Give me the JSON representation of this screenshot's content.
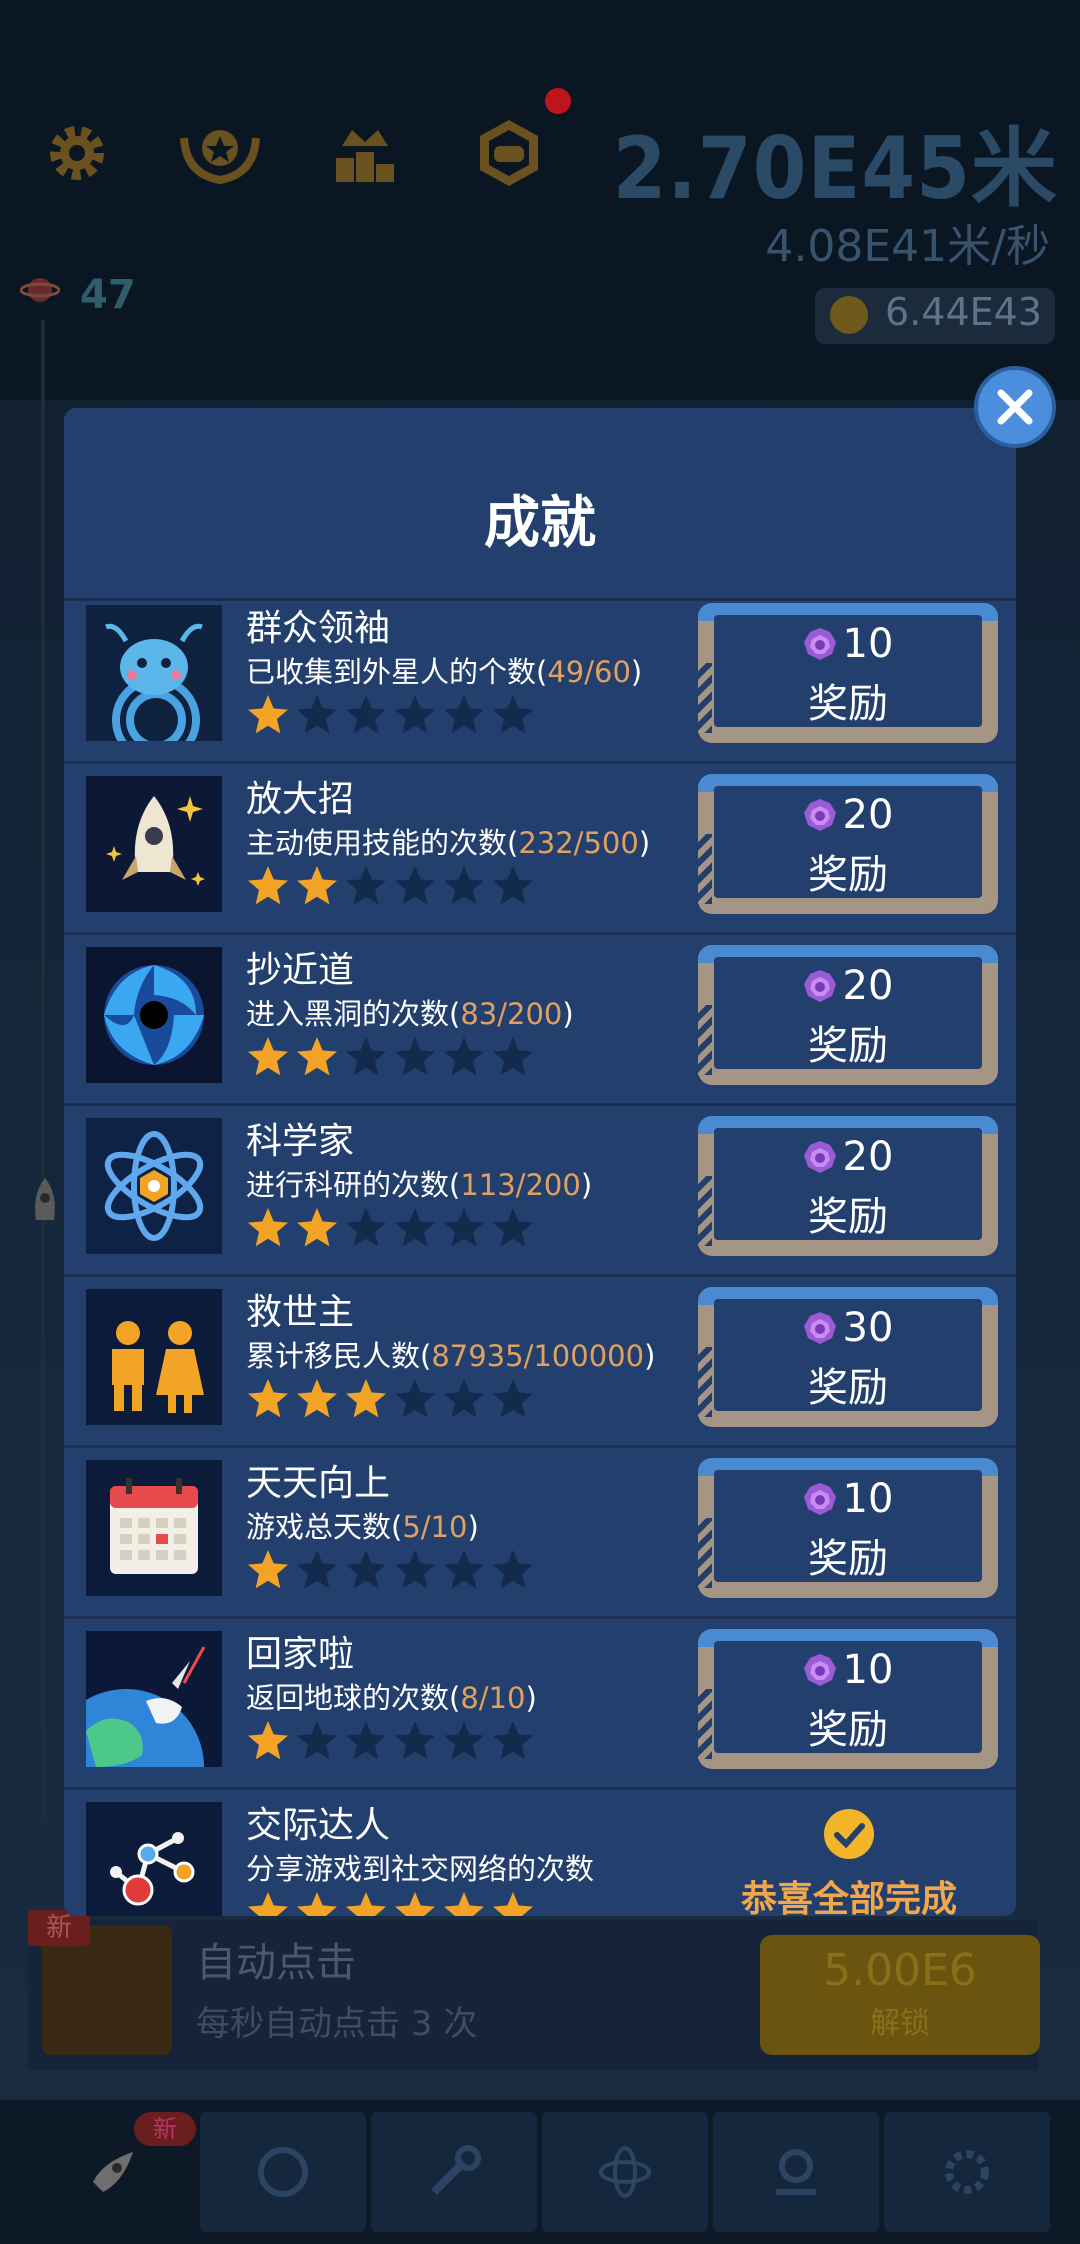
{
  "header": {
    "distance": "2.70E45米",
    "rate": "4.08E41米/秒",
    "coins": "6.44E43",
    "level": "47"
  },
  "upgrade": {
    "new_badge": "新",
    "title": "自动点击",
    "description": "每秒自动点击 3 次",
    "cost": "5.00E6",
    "unlock_label": "解锁"
  },
  "tabs": {
    "new_badge": "新"
  },
  "modal": {
    "title": "成就",
    "items": [
      {
        "name": "群众领袖",
        "desc_prefix": "已收集到外星人的个数(",
        "progress": "49/60",
        "desc_suffix": ")",
        "stars": 1,
        "reward": "10",
        "reward_label": "奖励"
      },
      {
        "name": "放大招",
        "desc_prefix": "主动使用技能的次数(",
        "progress": "232/500",
        "desc_suffix": ")",
        "stars": 2,
        "reward": "20",
        "reward_label": "奖励"
      },
      {
        "name": "抄近道",
        "desc_prefix": "进入黑洞的次数(",
        "progress": "83/200",
        "desc_suffix": ")",
        "stars": 2,
        "reward": "20",
        "reward_label": "奖励"
      },
      {
        "name": "科学家",
        "desc_prefix": "进行科研的次数(",
        "progress": "113/200",
        "desc_suffix": ")",
        "stars": 2,
        "reward": "20",
        "reward_label": "奖励"
      },
      {
        "name": "救世主",
        "desc_prefix": "累计移民人数(",
        "progress": "87935/100000",
        "desc_suffix": ")",
        "stars": 3,
        "reward": "30",
        "reward_label": "奖励"
      },
      {
        "name": "天天向上",
        "desc_prefix": "游戏总天数(",
        "progress": "5/10",
        "desc_suffix": ")",
        "stars": 1,
        "reward": "10",
        "reward_label": "奖励"
      },
      {
        "name": "回家啦",
        "desc_prefix": "返回地球的次数(",
        "progress": "8/10",
        "desc_suffix": ")",
        "stars": 1,
        "reward": "10",
        "reward_label": "奖励"
      },
      {
        "name": "交际达人",
        "desc_prefix": "分享游戏到社交网络的次数",
        "progress": "",
        "desc_suffix": "",
        "stars": 6,
        "completed_text": "恭喜全部完成"
      }
    ]
  },
  "colors": {
    "modal_bg": "#223f6e",
    "star_filled": "#f3a325",
    "star_empty": "#142a4c",
    "progress_text": "#e0a060",
    "reward_frame": "#a69585",
    "complete_text": "#f2a74a"
  }
}
